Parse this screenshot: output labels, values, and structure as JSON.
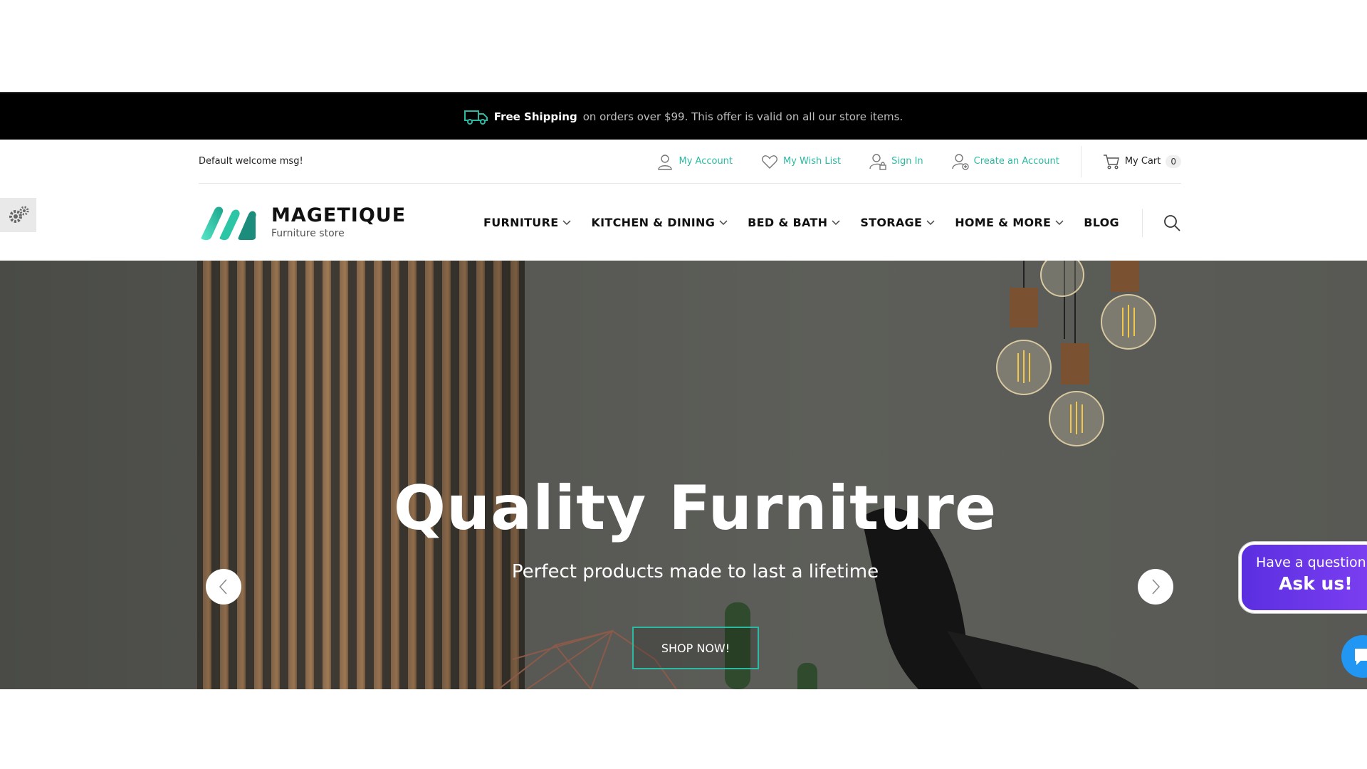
{
  "promo": {
    "strong": "Free Shipping",
    "rest": "on orders over $99. This offer is valid on all our store items.",
    "icon": "truck-icon"
  },
  "header": {
    "welcome": "Default welcome msg!",
    "links": {
      "account": "My Account",
      "wishlist": "My Wish List",
      "signin": "Sign In",
      "create": "Create an Account"
    },
    "cart": {
      "label": "My Cart",
      "count": "0"
    }
  },
  "brand": {
    "name": "MAGETIQUE",
    "tagline": "Furniture store"
  },
  "nav": {
    "items": [
      {
        "label": "FURNITURE",
        "has_dropdown": true
      },
      {
        "label": "KITCHEN & DINING",
        "has_dropdown": true
      },
      {
        "label": "BED & BATH",
        "has_dropdown": true
      },
      {
        "label": "STORAGE",
        "has_dropdown": true
      },
      {
        "label": "HOME & MORE",
        "has_dropdown": true
      },
      {
        "label": "BLOG",
        "has_dropdown": false
      }
    ]
  },
  "hero": {
    "title": "Quality Furniture",
    "subtitle": "Perfect products made to last a lifetime",
    "cta": "SHOP NOW!"
  },
  "chat": {
    "question": "Have a question?",
    "cta": "Ask us!"
  },
  "colors": {
    "accent": "#2cb9a1",
    "promo_bg": "#000000",
    "chat": "#6a35e8",
    "chat_fab": "#2196f3"
  }
}
